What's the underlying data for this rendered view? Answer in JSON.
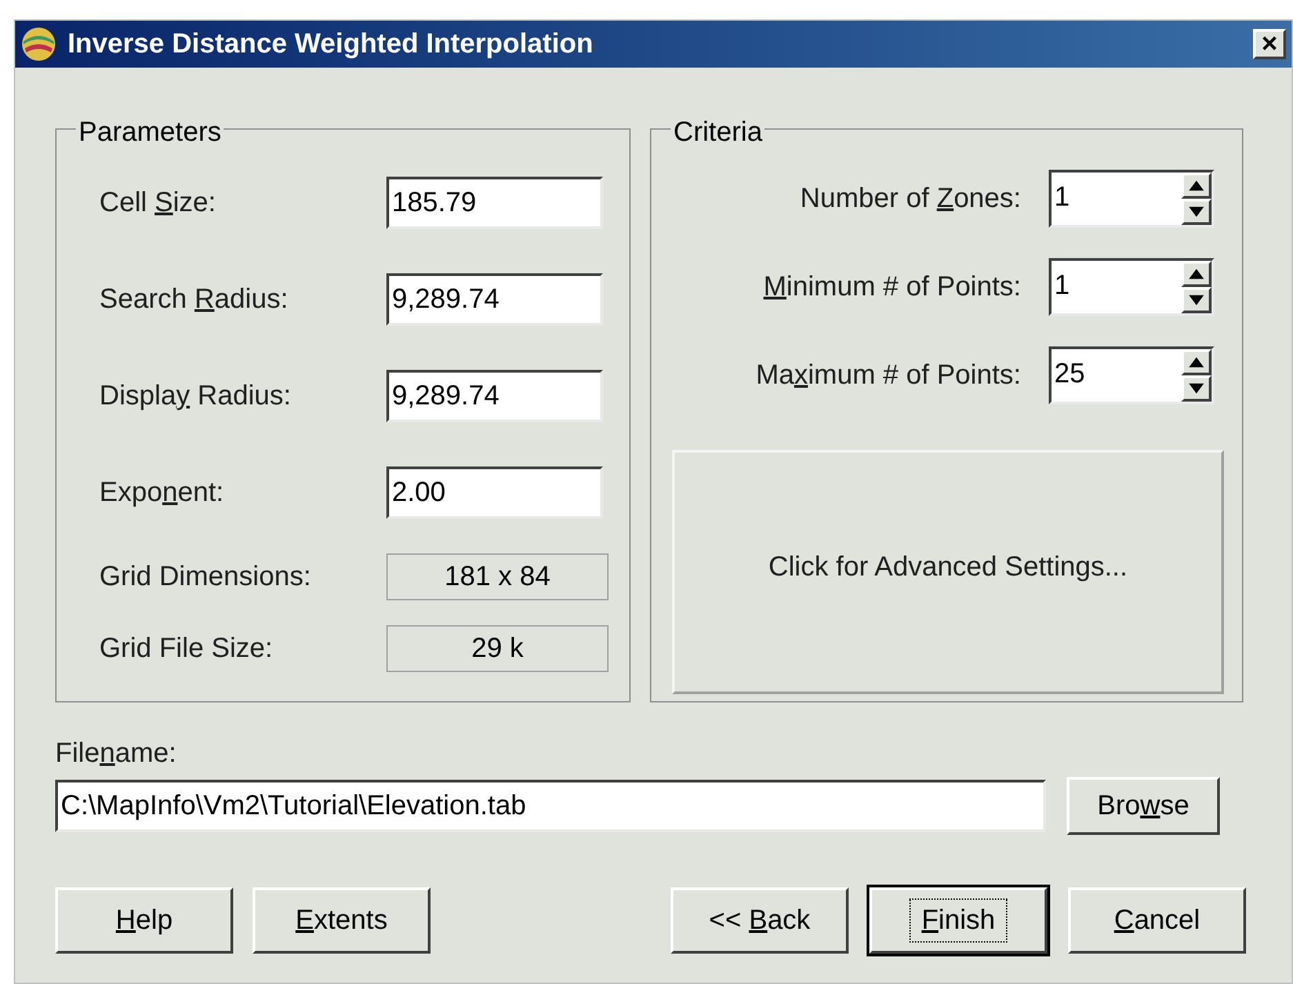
{
  "window": {
    "title": "Inverse Distance Weighted Interpolation",
    "close": "×"
  },
  "parameters": {
    "title": "Parameters",
    "fields": [
      {
        "kind": "input",
        "label": {
          "pre": "Cell ",
          "key": "S",
          "post": "ize:"
        },
        "value": "185.79"
      },
      {
        "kind": "input",
        "label": {
          "pre": "Search ",
          "key": "R",
          "post": "adius:"
        },
        "value": "9,289.74"
      },
      {
        "kind": "input",
        "label": {
          "pre": "Displa",
          "key": "y",
          "post": " Radius:"
        },
        "value": "9,289.74"
      },
      {
        "kind": "input",
        "label": {
          "pre": "Expo",
          "key": "n",
          "post": "ent:"
        },
        "value": "2.00"
      },
      {
        "kind": "readout",
        "label": {
          "pre": "Grid Dimensions:"
        },
        "value": "181 x 84"
      },
      {
        "kind": "readout",
        "label": {
          "pre": "Grid File Size:"
        },
        "value": "29 k"
      }
    ]
  },
  "criteria": {
    "title": "Criteria",
    "spinners": [
      {
        "label": {
          "pre": "Number of ",
          "key": "Z",
          "post": "ones:"
        },
        "value": "1"
      },
      {
        "label": {
          "key": "M",
          "post": "inimum # of Points:"
        },
        "value": "1"
      },
      {
        "label": {
          "pre": "Ma",
          "key": "x",
          "post": "imum # of Points:"
        },
        "value": "25"
      }
    ],
    "advanced_button": "Click for Advanced Settings..."
  },
  "filename": {
    "label": {
      "pre": "File",
      "key": "n",
      "post": "ame:"
    },
    "value": "C:\\MapInfo\\Vm2\\Tutorial\\Elevation.tab",
    "browse": {
      "pre": "Bro",
      "key": "w",
      "post": "se"
    }
  },
  "left_buttons": [
    {
      "label": {
        "key": "H",
        "post": "elp"
      },
      "default": false
    },
    {
      "label": {
        "key": "E",
        "post": "xtents"
      },
      "default": false
    }
  ],
  "right_buttons": [
    {
      "label": {
        "pre": "<< ",
        "key": "B",
        "post": "ack"
      },
      "default": false
    },
    {
      "label": {
        "key": "F",
        "post": "inish"
      },
      "default": true
    },
    {
      "label": {
        "key": "C",
        "post": "ancel"
      },
      "default": false
    }
  ]
}
